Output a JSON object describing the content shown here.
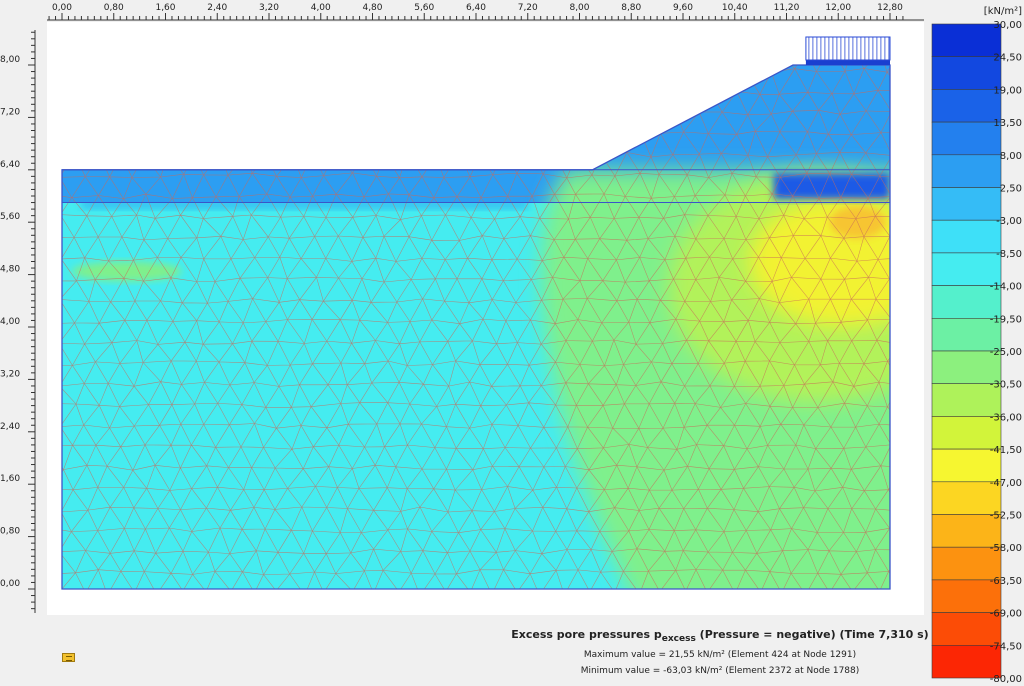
{
  "chart_data": {
    "type": "heatmap",
    "title": "Excess pore pressures p",
    "title_subscript": "excess",
    "title_suffix": "(Pressure = negative) (Time 7,310 s)",
    "unit": "[kN/m²]",
    "max_text": "Maximum value = 21,55 kN/m² (Element 424 at Node 1291)",
    "min_text": "Minimum value = -63,03 kN/m² (Element 2372 at Node 1788)",
    "max_value": 21.55,
    "min_value": -63.03,
    "xlim": [
      0.0,
      12.8
    ],
    "ylim": [
      0.0,
      8.0
    ],
    "x_ticks": [
      "0,00",
      "0,80",
      "1,60",
      "2,40",
      "3,20",
      "4,00",
      "4,80",
      "5,60",
      "6,40",
      "7,20",
      "8,00",
      "8,80",
      "9,60",
      "10,40",
      "11,20",
      "12,00",
      "12,80"
    ],
    "y_ticks": [
      "0,00",
      "0,80",
      "1,60",
      "2,40",
      "3,20",
      "4,00",
      "4,80",
      "5,60",
      "6,40",
      "7,20",
      "8,00"
    ],
    "legend_labels": [
      "30,00",
      "24,50",
      "19,00",
      "13,50",
      "8,00",
      "2,50",
      "-3,00",
      "-8,50",
      "-14,00",
      "-19,50",
      "-25,00",
      "-30,50",
      "-36,00",
      "-41,50",
      "-47,00",
      "-52,50",
      "-58,00",
      "-63,50",
      "-69,00",
      "-74,50",
      "-80,00"
    ],
    "legend_colors": [
      "#0a2fd6",
      "#1248e0",
      "#1a62e8",
      "#2380ee",
      "#2c9ef2",
      "#35bcf6",
      "#3ee0f8",
      "#45ecf0",
      "#54f0cc",
      "#6cf0a4",
      "#8cf07e",
      "#aef25a",
      "#d2f43a",
      "#f6f630",
      "#fcd622",
      "#fcb418",
      "#fc9210",
      "#fc700a",
      "#fc4c06",
      "#fc2604"
    ],
    "geometry": {
      "domain_x": [
        0.0,
        12.8
      ],
      "domain_y": [
        0.0,
        6.4
      ],
      "interface_y": 5.9,
      "embankment": [
        [
          8.2,
          6.4
        ],
        [
          11.3,
          8.0
        ],
        [
          12.8,
          8.0
        ],
        [
          12.8,
          6.4
        ]
      ],
      "load_x": [
        11.5,
        12.8
      ]
    },
    "regions": [
      {
        "desc": "background",
        "value": -6,
        "color": "#45ecf0"
      },
      {
        "desc": "top layer",
        "value": 6,
        "color": "#2c9ef2"
      },
      {
        "desc": "right green zone",
        "value": -22,
        "color": "#7ff08c"
      },
      {
        "desc": "yellow-green zone",
        "value": -32,
        "color": "#b2f25a"
      },
      {
        "desc": "yellow zone",
        "value": -40,
        "color": "#f2f232"
      },
      {
        "desc": "orange spot",
        "value": -50,
        "color": "#f7c530"
      },
      {
        "desc": "dark blue under load",
        "value": 20,
        "color": "#1f5ae6"
      }
    ]
  }
}
